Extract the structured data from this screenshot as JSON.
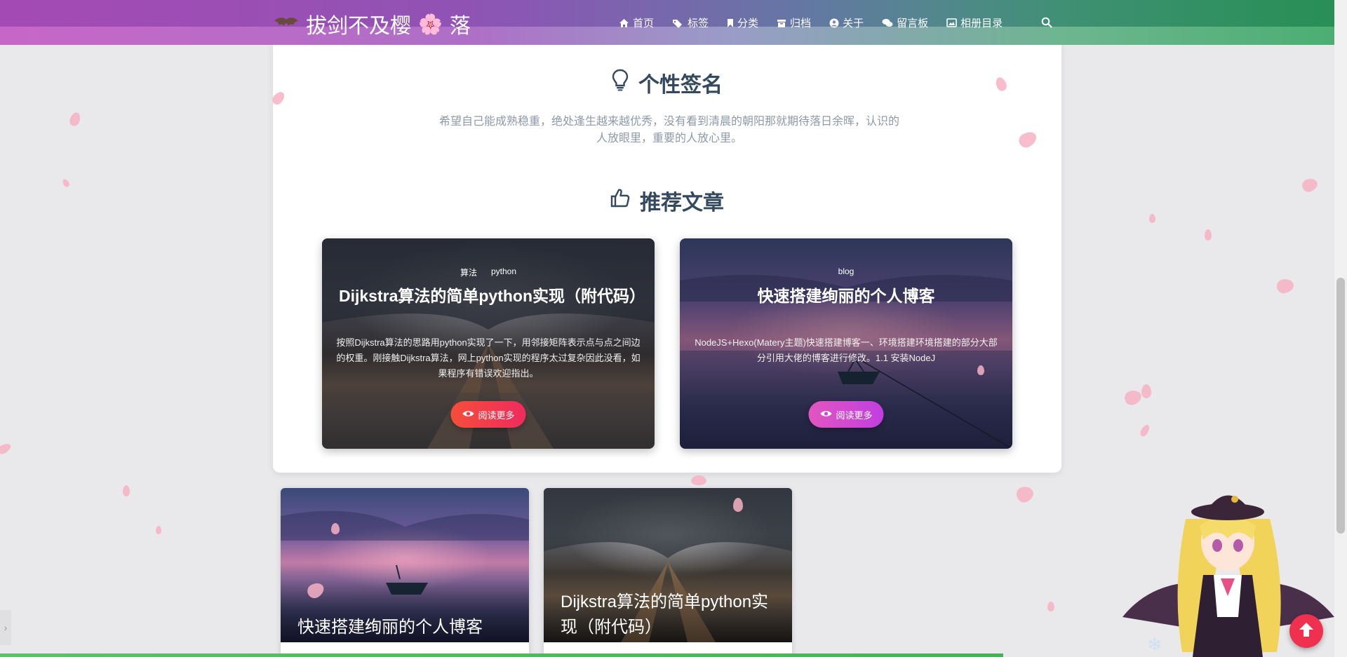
{
  "navbar": {
    "brand_text": "拔剑不及樱",
    "brand_suffix": "落",
    "brand_flower": "🌸",
    "items": [
      {
        "label": "首页",
        "icon": "home-icon"
      },
      {
        "label": "标签",
        "icon": "tags-icon"
      },
      {
        "label": "分类",
        "icon": "bookmark-icon"
      },
      {
        "label": "归档",
        "icon": "archive-icon"
      },
      {
        "label": "关于",
        "icon": "user-circle-icon"
      },
      {
        "label": "留言板",
        "icon": "comments-icon"
      },
      {
        "label": "相册目录",
        "icon": "image-icon"
      }
    ],
    "search_icon": "search-icon"
  },
  "motto": {
    "title": "个性签名",
    "icon": "lightbulb-icon",
    "text": "希望自己能成熟稳重，绝处逢生越来越优秀，没有看到清晨的朝阳那就期待落日余晖，认识的人放眼里，重要的人放心里。"
  },
  "recommended": {
    "title": "推荐文章",
    "icon": "thumbs-up-icon",
    "cards": [
      {
        "tags": [
          "算法",
          "python"
        ],
        "title": "Dijkstra算法的简单python实现（附代码）",
        "desc": "按照Dijkstra算法的思路用python实现了一下，用邻接矩阵表示点与点之间边的权重。刚接触Dijkstra算法，网上python实现的程序太过复杂因此没看，如果程序有错误欢迎指出。",
        "button": "阅读更多"
      },
      {
        "tags": [
          "blog"
        ],
        "title": "快速搭建绚丽的个人博客",
        "desc": "NodeJS+Hexo(Matery主题)快速搭建博客一、环境搭建环境搭建的部分大部分引用大佬的博客进行修改。1.1 安装NodeJ",
        "button": "阅读更多"
      }
    ]
  },
  "articles": [
    {
      "title": "快速搭建绚丽的个人博客"
    },
    {
      "title": "Dijkstra算法的简单python实现（附代码）"
    }
  ],
  "drawer_handle": "›",
  "colors": {
    "title_dark": "#34495e",
    "motto_gray": "#8e9aa8",
    "read_more_red": "#f54e3a",
    "read_more_pink": "#e256c0",
    "back_top": "#f0304f",
    "progress": "#5fbf6a"
  }
}
